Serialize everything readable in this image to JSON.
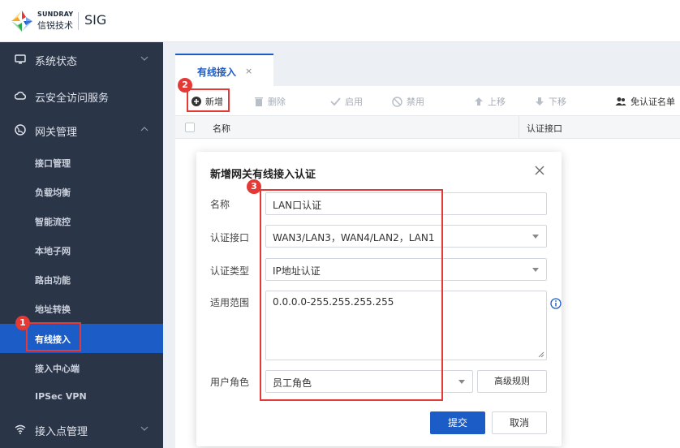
{
  "header": {
    "brand_en": "SUNDRAY",
    "brand_cn": "信锐技术",
    "product": "SIG"
  },
  "sidebar": {
    "groups": [
      {
        "label": "系统状态",
        "icon": "monitor-icon"
      },
      {
        "label": "云安全访问服务",
        "icon": "cloud-icon"
      },
      {
        "label": "网关管理",
        "icon": "globe-icon"
      },
      {
        "label": "接入点管理",
        "icon": "wifi-icon"
      }
    ],
    "items": [
      {
        "label": "接口管理"
      },
      {
        "label": "负载均衡"
      },
      {
        "label": "智能流控"
      },
      {
        "label": "本地子网"
      },
      {
        "label": "路由功能"
      },
      {
        "label": "地址转换"
      },
      {
        "label": "有线接入",
        "active": true
      },
      {
        "label": "接入中心端"
      },
      {
        "label": "IPSec VPN"
      }
    ]
  },
  "tabs": [
    {
      "label": "有线接入",
      "close": "×"
    }
  ],
  "toolbar": {
    "add": "新增",
    "delete": "删除",
    "enable": "启用",
    "disable": "禁用",
    "move_up": "上移",
    "move_down": "下移",
    "exempt_list": "免认证名单"
  },
  "table": {
    "columns": [
      "名称",
      "认证接口"
    ]
  },
  "dialog": {
    "title": "新增网关有线接入认证",
    "name_label": "名称",
    "name_value": "LAN口认证",
    "iface_label": "认证接口",
    "iface_value": "WAN3/LAN3，WAN4/LAN2，LAN1",
    "type_label": "认证类型",
    "type_value": "IP地址认证",
    "scope_label": "适用范围",
    "scope_value": "0.0.0.0-255.255.255.255",
    "role_label": "用户角色",
    "role_value": "员工角色",
    "advanced": "高级规则",
    "submit": "提交",
    "cancel": "取消"
  },
  "annotations": [
    "1",
    "2",
    "3"
  ],
  "colors": {
    "sidebar_bg": "#2b3548",
    "accent": "#1c5cc7",
    "annotation": "#e53935"
  }
}
